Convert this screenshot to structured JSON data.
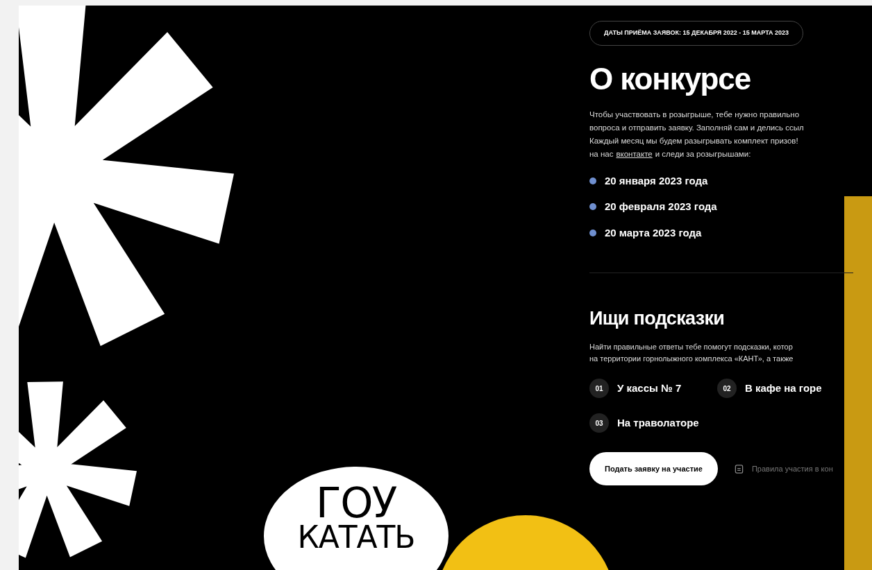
{
  "dates_badge": "ДАТЫ ПРИЁМА ЗАЯВОК: 15 ДЕКАБРЯ 2022 - 15 МАРТА 2023",
  "about": {
    "title": "О конкурсе",
    "lines": [
      {
        "text": "Чтобы участвовать в розыгрыше, тебе нужно правильно"
      },
      {
        "text": "вопроса и отправить заявку. Заполняй сам и делись ссыл"
      },
      {
        "text": "Каждый месяц мы будем разыгрывать комплект призов!"
      },
      {
        "text": "на нас",
        "link": "вконтакте",
        "after": "и следи за розыгрышами:"
      }
    ],
    "draw_dates": [
      "20 января 2023 года",
      "20 февраля 2023 года",
      "20 марта 2023 года"
    ]
  },
  "hints": {
    "title": "Ищи подсказки",
    "lines": [
      "Найти правильные ответы тебе помогут подсказки, котор",
      "на территории горнолыжного комплекса «КАНТ», а также"
    ],
    "items": [
      {
        "number": "01",
        "label": "У кассы № 7"
      },
      {
        "number": "02",
        "label": "В кафе на горе"
      },
      {
        "number": "03",
        "label": "На траволаторе"
      }
    ]
  },
  "apply_button": "Подать заявку на участие",
  "rules_link": "Правила участия в кон",
  "sticker": [
    "ГОУ",
    "КАТАТЬ"
  ]
}
